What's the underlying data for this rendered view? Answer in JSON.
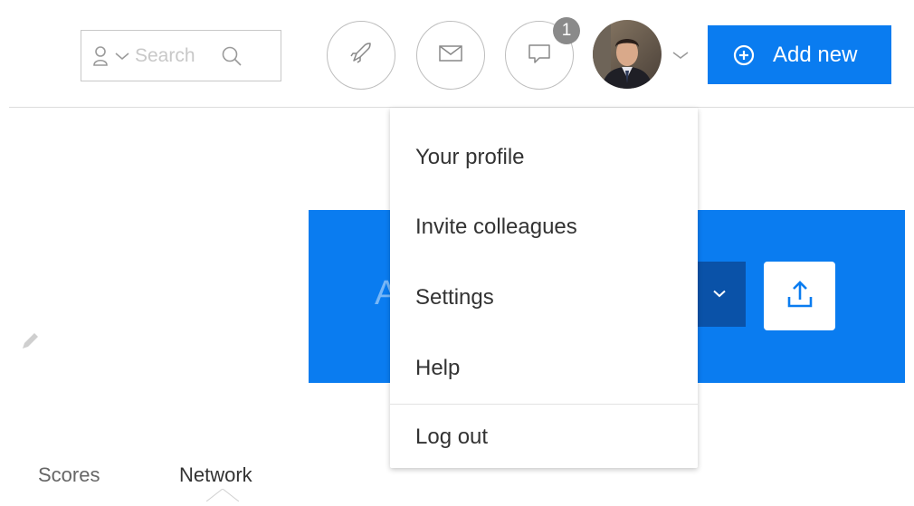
{
  "header": {
    "search": {
      "placeholder": "Search"
    },
    "icons": {
      "user": "user-icon",
      "dropdown_caret": "chevron-down-icon",
      "search": "search-icon",
      "rocket": "rocket-icon",
      "mail": "mail-icon",
      "chat": "chat-icon",
      "plus": "plus-circle-icon"
    },
    "notifications_badge": "1",
    "add_new_label": "Add new"
  },
  "user_menu": {
    "items": [
      {
        "label": "Your profile"
      },
      {
        "label": "Invite colleagues"
      },
      {
        "label": "Settings"
      },
      {
        "label": "Help"
      },
      {
        "label": "Log out"
      }
    ]
  },
  "content": {
    "banner_partial_text": "A",
    "tabs": [
      {
        "label": "Scores"
      },
      {
        "label": "Network",
        "active": true
      }
    ]
  },
  "colors": {
    "accent": "#0a7cf0",
    "accent_dark": "#0a52a8",
    "badge": "#8a8a8a",
    "text": "#333333"
  }
}
